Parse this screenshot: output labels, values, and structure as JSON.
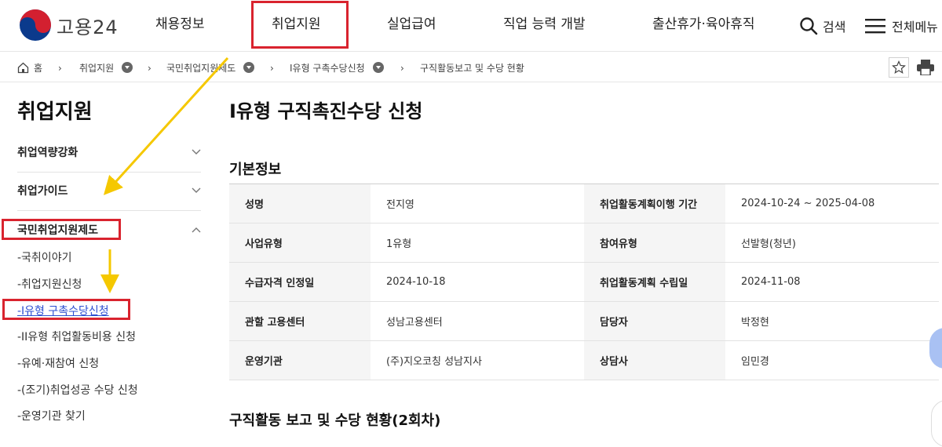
{
  "header": {
    "logo_text": "고용24",
    "nav": [
      "채용정보",
      "취업지원",
      "실업급여",
      "직업 능력 개발",
      "출산휴가·육아휴직"
    ],
    "search_label": "검색",
    "menu_label": "전체메뉴"
  },
  "breadcrumb": {
    "home": "홈",
    "items": [
      "취업지원",
      "국민취업지원제도",
      "I유형 구촉수당신청",
      "구직활동보고 및 수당 현황"
    ]
  },
  "sidebar": {
    "title": "취업지원",
    "menus": [
      "취업역량강화",
      "취업가이드",
      "국민취업지원제도"
    ],
    "sub_items": [
      "-국취이야기",
      "-취업지원신청",
      "-I유형 구촉수당신청",
      "-II유형 취업활동비용 신청",
      "-유예·재참여 신청",
      "-(조기)취업성공 수당 신청",
      "-운영기관 찾기"
    ]
  },
  "main": {
    "title": "I유형 구직촉진수당 신청",
    "section1_title": "기본정보",
    "rows": [
      [
        "성명",
        "전지영",
        "취업활동계획이행 기간",
        "2024-10-24 ~ 2025-04-08"
      ],
      [
        "사업유형",
        "1유형",
        "참여유형",
        "선발형(청년)"
      ],
      [
        "수급자격 인정일",
        "2024-10-18",
        "취업활동계획 수립일",
        "2024-11-08"
      ],
      [
        "관할 고용센터",
        "성남고용센터",
        "담당자",
        "박정현"
      ],
      [
        "운영기관",
        "(주)지오코칭 성남지사",
        "상담사",
        "임민경"
      ]
    ],
    "section2_title": "구직활동 보고 및 수당 현황(2회차)"
  },
  "colors": {
    "highlight": "#d9232e",
    "arrow": "#f5c800",
    "link": "#2d4fd1"
  }
}
